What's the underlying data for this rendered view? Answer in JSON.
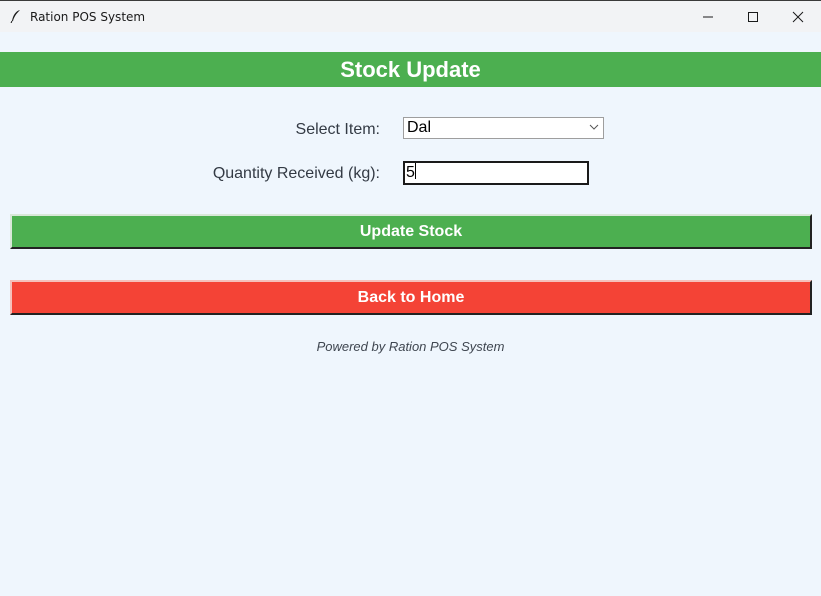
{
  "window": {
    "title": "Ration POS System",
    "icon": "feather-icon"
  },
  "header": {
    "title": "Stock Update"
  },
  "form": {
    "select_label": "Select Item:",
    "selected_item": "Dal",
    "quantity_label": "Quantity Received (kg):",
    "quantity_value": "5"
  },
  "buttons": {
    "update_label": "Update Stock",
    "back_label": "Back to Home"
  },
  "footer": {
    "text": "Powered by Ration POS System"
  },
  "colors": {
    "header_bg": "#4caf50",
    "update_bg": "#4caf50",
    "back_bg": "#f44336",
    "page_bg": "#eff6fd"
  }
}
